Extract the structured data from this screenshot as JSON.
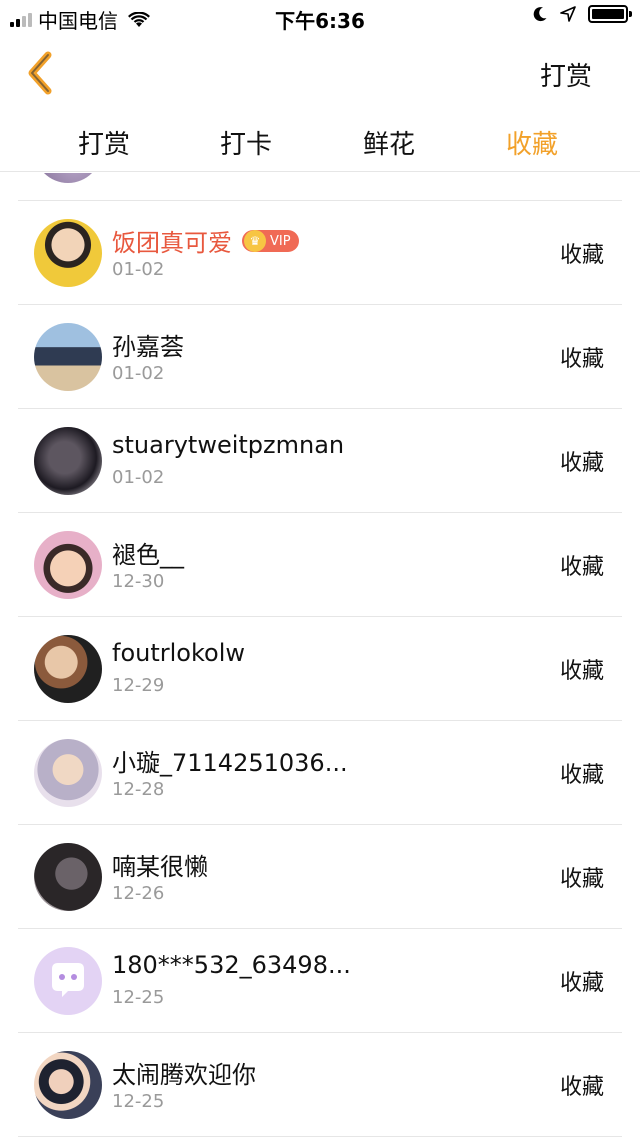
{
  "status_bar": {
    "carrier": "中国电信",
    "time": "下午6:36"
  },
  "nav": {
    "right_label": "打赏"
  },
  "tabs": [
    {
      "label": "打赏",
      "active": false
    },
    {
      "label": "打卡",
      "active": false
    },
    {
      "label": "鲜花",
      "active": false
    },
    {
      "label": "收藏",
      "active": true
    }
  ],
  "colors": {
    "accent": "#f2a12a",
    "vip_name": "#e8583e",
    "date": "#9a9a9a"
  },
  "list": {
    "items": [
      {
        "name": "饭团真可爱",
        "date": "01-02",
        "action": "收藏",
        "vip": true,
        "vip_label": "VIP"
      },
      {
        "name": "孙嘉荟",
        "date": "01-02",
        "action": "收藏"
      },
      {
        "name": "stuarytweitpzmnan",
        "date": "01-02",
        "action": "收藏"
      },
      {
        "name": "褪色__",
        "date": "12-30",
        "action": "收藏"
      },
      {
        "name": "foutrlokolw",
        "date": "12-29",
        "action": "收藏"
      },
      {
        "name": "小璇_7114251036...",
        "date": "12-28",
        "action": "收藏"
      },
      {
        "name": "喃某很懒",
        "date": "12-26",
        "action": "收藏"
      },
      {
        "name": "180***532_63498...",
        "date": "12-25",
        "action": "收藏"
      },
      {
        "name": "太闹腾欢迎你",
        "date": "12-25",
        "action": "收藏"
      }
    ]
  }
}
